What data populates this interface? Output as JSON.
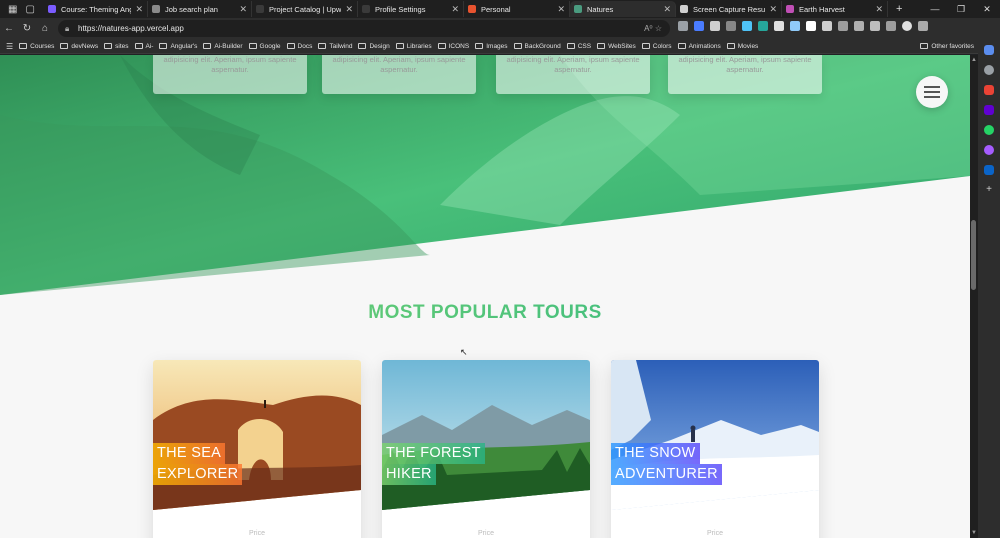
{
  "browser": {
    "tabs": [
      {
        "title": "Course: Theming Angular",
        "color": "#7b5cff",
        "active": false
      },
      {
        "title": "Job search plan",
        "color": "#8a8a8a",
        "active": false
      },
      {
        "title": "Project Catalog | Upwork",
        "color": "#3a3a3a",
        "active": false
      },
      {
        "title": "Profile Settings",
        "color": "#3a3a3a",
        "active": false
      },
      {
        "title": "Personal",
        "color": "#e8532f",
        "active": false
      },
      {
        "title": "Natures",
        "color": "#4a9b7f",
        "active": true
      },
      {
        "title": "Screen Capture Result",
        "color": "#d0d0d0",
        "active": false
      },
      {
        "title": "Earth Harvest",
        "color": "#c04fb5",
        "active": false
      }
    ],
    "url": "https://natures-app.vercel.app",
    "bookmarks": [
      "Courses",
      "devNews",
      "sites",
      "Ai-",
      "Angular's",
      "Ai-Builder",
      "Google",
      "Docs",
      "Tailwind",
      "Design",
      "Libraries",
      "ICONS",
      "Images",
      "BackGround",
      "CSS",
      "WebSites",
      "Colors",
      "Animations",
      "Movies"
    ],
    "other_favorites": "Other favorites"
  },
  "page": {
    "feature_text": "adipisicing elit. Aperiam, ipsum sapiente aspernatur.",
    "section_title": "MOST POPULAR TOURS",
    "tours": [
      {
        "line1": "THE SEA",
        "line2": "EXPLORER",
        "label_color": "#ffb900",
        "label_color2": "#ff7730",
        "footnote": "Price"
      },
      {
        "line1": "THE FOREST",
        "line2": "HIKER",
        "label_color": "#7ed56f",
        "label_color2": "#28b485",
        "footnote": "Price"
      },
      {
        "line1": "THE SNOW",
        "line2": "ADVENTURER",
        "label_color": "#2998ff",
        "label_color2": "#5643fa",
        "footnote": "Price"
      }
    ]
  },
  "colors": {
    "brand_green": "#55c57a",
    "hero_green": "#28b485"
  }
}
